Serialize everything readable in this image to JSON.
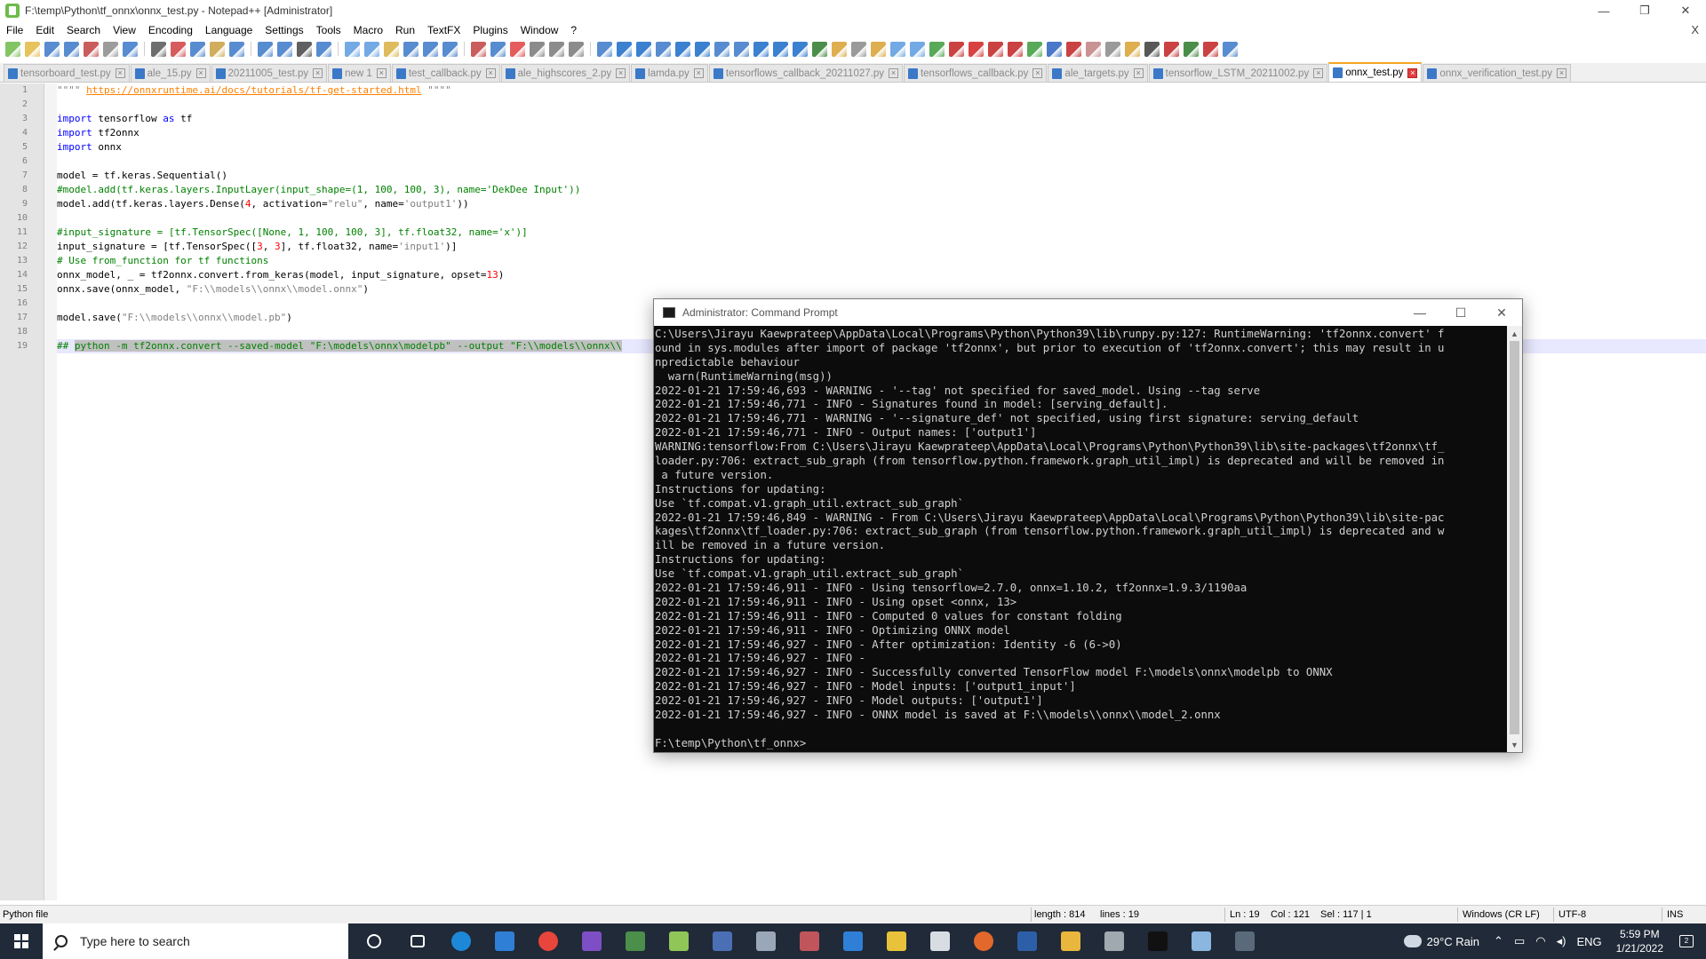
{
  "window": {
    "title": "F:\\temp\\Python\\tf_onnx\\onnx_test.py - Notepad++ [Administrator]",
    "minimize": "—",
    "maximize": "❐",
    "close": "✕"
  },
  "menu": {
    "items": [
      "File",
      "Edit",
      "Search",
      "View",
      "Encoding",
      "Language",
      "Settings",
      "Tools",
      "Macro",
      "Run",
      "TextFX",
      "Plugins",
      "Window",
      "?"
    ],
    "close": "X"
  },
  "tabs": [
    {
      "label": "tensorboard_test.py",
      "active": false
    },
    {
      "label": "ale_15.py",
      "active": false
    },
    {
      "label": "20211005_test.py",
      "active": false
    },
    {
      "label": "new 1",
      "active": false
    },
    {
      "label": "test_callback.py",
      "active": false
    },
    {
      "label": "ale_highscores_2.py",
      "active": false
    },
    {
      "label": "lamda.py",
      "active": false
    },
    {
      "label": "tensorflows_callback_20211027.py",
      "active": false
    },
    {
      "label": "tensorflows_callback.py",
      "active": false
    },
    {
      "label": "ale_targets.py",
      "active": false
    },
    {
      "label": "tensorflow_LSTM_20211002.py",
      "active": false
    },
    {
      "label": "onnx_test.py",
      "active": true
    },
    {
      "label": "onnx_verification_test.py",
      "active": false
    }
  ],
  "editor": {
    "line_numbers": [
      "1",
      "2",
      "3",
      "4",
      "5",
      "6",
      "7",
      "8",
      "9",
      "10",
      "11",
      "12",
      "13",
      "14",
      "15",
      "16",
      "17",
      "18",
      "19"
    ],
    "current_line": 19,
    "lines": [
      [
        {
          "t": "\"\"\"\" ",
          "c": "str"
        },
        {
          "t": "https://onnxruntime.ai/docs/tutorials/tf-get-started.html",
          "c": "url"
        },
        {
          "t": " \"\"\"\"",
          "c": "str"
        }
      ],
      [],
      [
        {
          "t": "import",
          "c": "kw"
        },
        {
          "t": " tensorflow ",
          "c": ""
        },
        {
          "t": "as",
          "c": "kw"
        },
        {
          "t": " tf",
          "c": ""
        }
      ],
      [
        {
          "t": "import",
          "c": "kw"
        },
        {
          "t": " tf2onnx",
          "c": ""
        }
      ],
      [
        {
          "t": "import",
          "c": "kw"
        },
        {
          "t": " onnx",
          "c": ""
        }
      ],
      [],
      [
        {
          "t": "model = tf.keras.Sequential()",
          "c": ""
        }
      ],
      [
        {
          "t": "#model.add(tf.keras.layers.InputLayer(input_shape=(1, 100, 100, 3), name='DekDee Input'))",
          "c": "com"
        }
      ],
      [
        {
          "t": "model.add(tf.keras.layers.Dense(",
          "c": ""
        },
        {
          "t": "4",
          "c": "num"
        },
        {
          "t": ", activation=",
          "c": ""
        },
        {
          "t": "\"relu\"",
          "c": "str"
        },
        {
          "t": ", name=",
          "c": ""
        },
        {
          "t": "'output1'",
          "c": "str"
        },
        {
          "t": "))",
          "c": ""
        }
      ],
      [],
      [
        {
          "t": "#input_signature = [tf.TensorSpec([None, 1, 100, 100, 3], tf.float32, name='x')]",
          "c": "com"
        }
      ],
      [
        {
          "t": "input_signature = [tf.TensorSpec([",
          "c": ""
        },
        {
          "t": "3",
          "c": "num"
        },
        {
          "t": ", ",
          "c": ""
        },
        {
          "t": "3",
          "c": "num"
        },
        {
          "t": "], tf.float32, name=",
          "c": ""
        },
        {
          "t": "'input1'",
          "c": "str"
        },
        {
          "t": ")]",
          "c": ""
        }
      ],
      [
        {
          "t": "# Use from_function for tf functions",
          "c": "com"
        }
      ],
      [
        {
          "t": "onnx_model, _ = tf2onnx.convert.from_keras(model, input_signature, opset=",
          "c": ""
        },
        {
          "t": "13",
          "c": "num"
        },
        {
          "t": ")",
          "c": ""
        }
      ],
      [
        {
          "t": "onnx.save(onnx_model, ",
          "c": ""
        },
        {
          "t": "\"F:\\\\models\\\\onnx\\\\model.onnx\"",
          "c": "str"
        },
        {
          "t": ")",
          "c": ""
        }
      ],
      [],
      [
        {
          "t": "model.save(",
          "c": ""
        },
        {
          "t": "\"F:\\\\models\\\\onnx\\\\model.pb\"",
          "c": "str"
        },
        {
          "t": ")",
          "c": ""
        }
      ],
      [],
      [
        {
          "t": "## ",
          "c": "com"
        },
        {
          "t": "python -m tf2onnx.convert --saved-model \"F:\\models\\onnx\\modelpb\" --output \"F:\\\\models\\\\onnx\\\\",
          "c": "sel"
        }
      ]
    ]
  },
  "cmd": {
    "title": "Administrator: Command Prompt",
    "minimize": "—",
    "maximize": "☐",
    "close": "✕",
    "lines": [
      "C:\\Users\\Jirayu Kaewprateep\\AppData\\Local\\Programs\\Python\\Python39\\lib\\runpy.py:127: RuntimeWarning: 'tf2onnx.convert' f",
      "ound in sys.modules after import of package 'tf2onnx', but prior to execution of 'tf2onnx.convert'; this may result in u",
      "npredictable behaviour",
      "  warn(RuntimeWarning(msg))",
      "2022-01-21 17:59:46,693 - WARNING - '--tag' not specified for saved_model. Using --tag serve",
      "2022-01-21 17:59:46,771 - INFO - Signatures found in model: [serving_default].",
      "2022-01-21 17:59:46,771 - WARNING - '--signature_def' not specified, using first signature: serving_default",
      "2022-01-21 17:59:46,771 - INFO - Output names: ['output1']",
      "WARNING:tensorflow:From C:\\Users\\Jirayu Kaewprateep\\AppData\\Local\\Programs\\Python\\Python39\\lib\\site-packages\\tf2onnx\\tf_",
      "loader.py:706: extract_sub_graph (from tensorflow.python.framework.graph_util_impl) is deprecated and will be removed in",
      " a future version.",
      "Instructions for updating:",
      "Use `tf.compat.v1.graph_util.extract_sub_graph`",
      "2022-01-21 17:59:46,849 - WARNING - From C:\\Users\\Jirayu Kaewprateep\\AppData\\Local\\Programs\\Python\\Python39\\lib\\site-pac",
      "kages\\tf2onnx\\tf_loader.py:706: extract_sub_graph (from tensorflow.python.framework.graph_util_impl) is deprecated and w",
      "ill be removed in a future version.",
      "Instructions for updating:",
      "Use `tf.compat.v1.graph_util.extract_sub_graph`",
      "2022-01-21 17:59:46,911 - INFO - Using tensorflow=2.7.0, onnx=1.10.2, tf2onnx=1.9.3/1190aa",
      "2022-01-21 17:59:46,911 - INFO - Using opset <onnx, 13>",
      "2022-01-21 17:59:46,911 - INFO - Computed 0 values for constant folding",
      "2022-01-21 17:59:46,911 - INFO - Optimizing ONNX model",
      "2022-01-21 17:59:46,927 - INFO - After optimization: Identity -6 (6->0)",
      "2022-01-21 17:59:46,927 - INFO - ",
      "2022-01-21 17:59:46,927 - INFO - Successfully converted TensorFlow model F:\\models\\onnx\\modelpb to ONNX",
      "2022-01-21 17:59:46,927 - INFO - Model inputs: ['output1_input']",
      "2022-01-21 17:59:46,927 - INFO - Model outputs: ['output1']",
      "2022-01-21 17:59:46,927 - INFO - ONNX model is saved at F:\\\\models\\\\onnx\\\\model_2.onnx",
      "",
      "F:\\temp\\Python\\tf_onnx>"
    ],
    "scroll_up": "▲",
    "scroll_down": "▼"
  },
  "statusbar": {
    "file_type": "Python file",
    "length": "length : 814",
    "lines": "lines : 19",
    "ln": "Ln : 19",
    "col": "Col : 121",
    "sel": "Sel : 117 | 1",
    "eol": "Windows (CR LF)",
    "encoding": "UTF-8",
    "mode": "INS"
  },
  "taskbar": {
    "search_placeholder": "Type here to search",
    "weather": "29°C  Rain",
    "language": "ENG",
    "time": "5:59 PM",
    "date": "1/21/2022",
    "notifications": "2",
    "apps": [
      {
        "name": "cortana-icon",
        "color": "#202a38"
      },
      {
        "name": "task-view-icon",
        "color": "#202a38"
      },
      {
        "name": "edge-icon",
        "color": "#1e88d8"
      },
      {
        "name": "mail-icon",
        "color": "#2f7fd6"
      },
      {
        "name": "chrome-icon",
        "color": "#e8453c"
      },
      {
        "name": "visual-studio-icon",
        "color": "#7e4fc4"
      },
      {
        "name": "file-app-icon",
        "color": "#4b8f4b"
      },
      {
        "name": "notepadpp-icon",
        "color": "#8fc657"
      },
      {
        "name": "network-app-icon",
        "color": "#4a6fb5"
      },
      {
        "name": "paint-icon",
        "color": "#9aa7b8"
      },
      {
        "name": "media-app-icon",
        "color": "#c0555c"
      },
      {
        "name": "editor-app-icon",
        "color": "#2f7fd6"
      },
      {
        "name": "sticky-icon",
        "color": "#e8c23a"
      },
      {
        "name": "cube-icon",
        "color": "#d8dde4"
      },
      {
        "name": "matlab-icon",
        "color": "#e2682b"
      },
      {
        "name": "powershell-icon",
        "color": "#2d5fa8"
      },
      {
        "name": "explorer-icon",
        "color": "#e9b73d"
      },
      {
        "name": "settings-app-icon",
        "color": "#a0a8b0"
      },
      {
        "name": "terminal-icon",
        "color": "#111111"
      },
      {
        "name": "notepad-icon",
        "color": "#8ab6e0"
      },
      {
        "name": "calculator-icon",
        "color": "#5a6a7a"
      }
    ]
  },
  "colors": {
    "active_tab_accent": "#f5a623",
    "keyword": "#0000ff",
    "string": "#808080",
    "number": "#ff0000",
    "comment": "#008000",
    "url": "#ff8000",
    "taskbar": "#202a38"
  }
}
